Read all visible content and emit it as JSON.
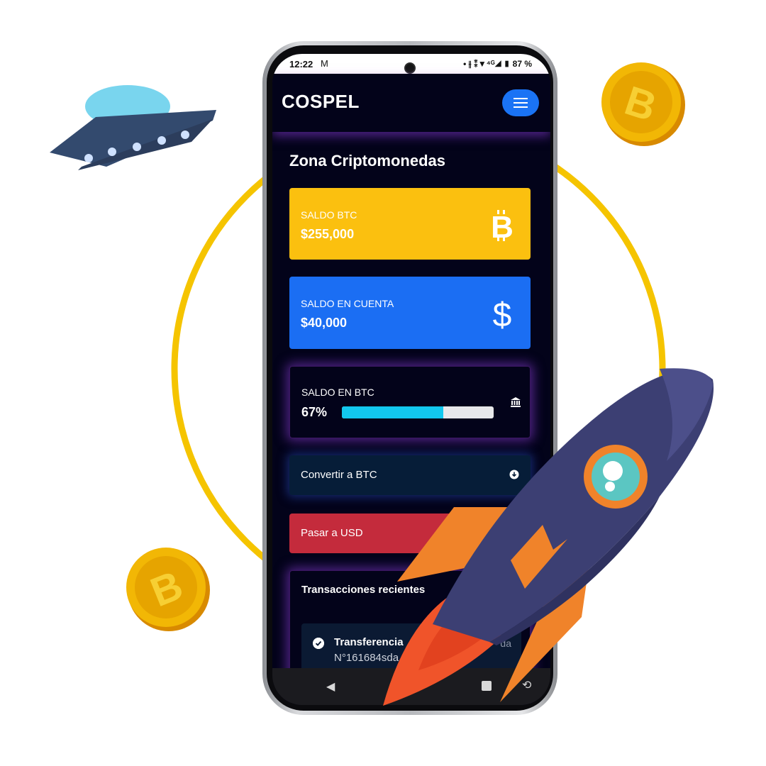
{
  "status_bar": {
    "time": "12:22",
    "mail_icon": "M",
    "indicators": "• ⫲ ⁑▼⁴ᴳ◢ ▮ 87 %"
  },
  "app": {
    "brand": "COSPEL",
    "menu_icon": "hamburger-icon"
  },
  "main": {
    "section_title": "Zona Criptomonedas",
    "cards": {
      "btc": {
        "label": "SALDO BTC",
        "value": "$255,000",
        "icon": "bitcoin-icon",
        "color": "#fbc00f"
      },
      "cuenta": {
        "label": "SALDO EN CUENTA",
        "value": "$40,000",
        "icon": "dollar-icon",
        "color": "#1b6ef3"
      },
      "progress": {
        "label": "SALDO EN BTC",
        "percent_text": "67%",
        "percent_value": 0.67,
        "icon": "bank-icon",
        "bar_color": "#12c8ee"
      }
    },
    "actions": {
      "convert": {
        "label": "Convertir a BTC",
        "icon": "download-circle-icon"
      },
      "usd": {
        "label": "Pasar a USD",
        "color": "#c42b3c"
      }
    },
    "transactions": {
      "title": "Transacciones recientes",
      "items": [
        {
          "name": "Transferencia",
          "ref": "N°161684sda",
          "status": "da",
          "icon": "check-circle-icon"
        }
      ]
    }
  },
  "nav": {
    "back_icon": "back-triangle-icon",
    "home_icon": "square-icon",
    "rotate_icon": "rotate-icon"
  },
  "colors": {
    "ring": "#f5c400",
    "coin": "#f2b705",
    "rocket_body": "#3c3f73",
    "flame": "#f0832a"
  }
}
